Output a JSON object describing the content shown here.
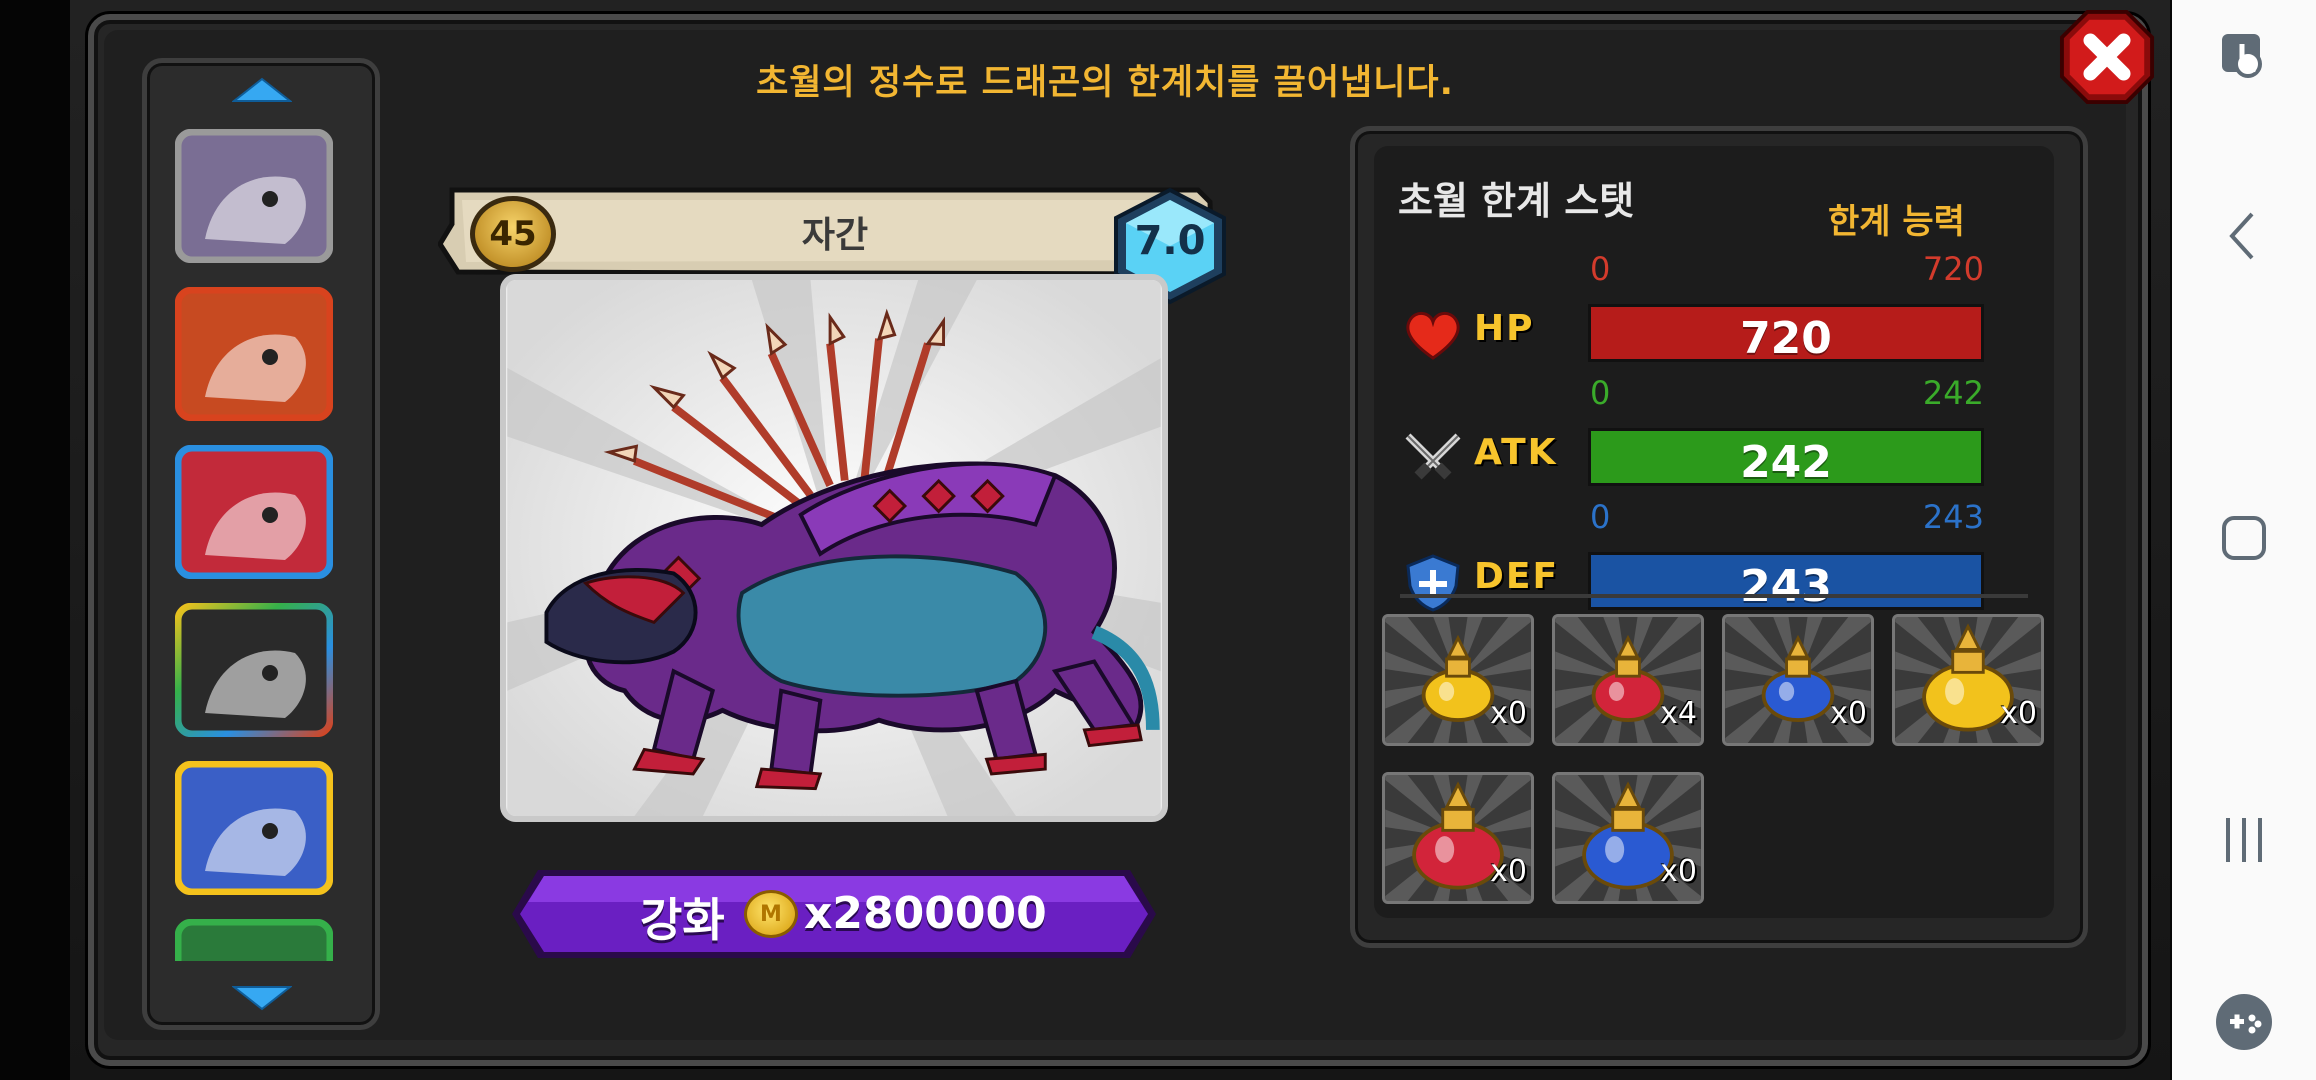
{
  "header": {
    "title": "초월의 정수로 드래곤의 한계치를 끌어냅니다."
  },
  "dragon": {
    "level": "45",
    "name": "자간",
    "grade": "7.0"
  },
  "enhance": {
    "label": "강화",
    "coin_symbol": "M",
    "cost": "x2800000"
  },
  "stats_panel": {
    "title": "초월 한계 스탯",
    "limit_label": "한계 능력",
    "stats": [
      {
        "name": "HP",
        "min": "0",
        "max": "720",
        "value": "720",
        "fill": 1.0,
        "color": "#b61c1a",
        "label_color": "#d33b2c"
      },
      {
        "name": "ATK",
        "min": "0",
        "max": "242",
        "value": "242",
        "fill": 1.0,
        "color": "#2c9a1b",
        "label_color": "#3aab2a"
      },
      {
        "name": "DEF",
        "min": "0",
        "max": "243",
        "value": "243",
        "fill": 1.0,
        "color": "#1a53a3",
        "label_color": "#2b72c9"
      }
    ]
  },
  "items": [
    {
      "type": "yellow-potion-small",
      "count": "x0"
    },
    {
      "type": "red-potion-small",
      "count": "x4"
    },
    {
      "type": "blue-potion-small",
      "count": "x0"
    },
    {
      "type": "yellow-potion-large",
      "count": "x0"
    },
    {
      "type": "red-potion-large",
      "count": "x0"
    },
    {
      "type": "blue-potion-large",
      "count": "x0"
    }
  ],
  "dragon_list": [
    {
      "frame": "#9a9a9a",
      "bg": "#7a6e94"
    },
    {
      "frame": "#d8431e",
      "bg": "#c74a21"
    },
    {
      "frame": "#2a8fe0",
      "bg": "#c22a3a"
    },
    {
      "frame": "rainbow",
      "bg": "#2a2a2a"
    },
    {
      "frame": "#f4c21c",
      "bg": "#3a5fc6"
    },
    {
      "frame": "#35b04a",
      "bg": "#2a7a3a"
    }
  ]
}
